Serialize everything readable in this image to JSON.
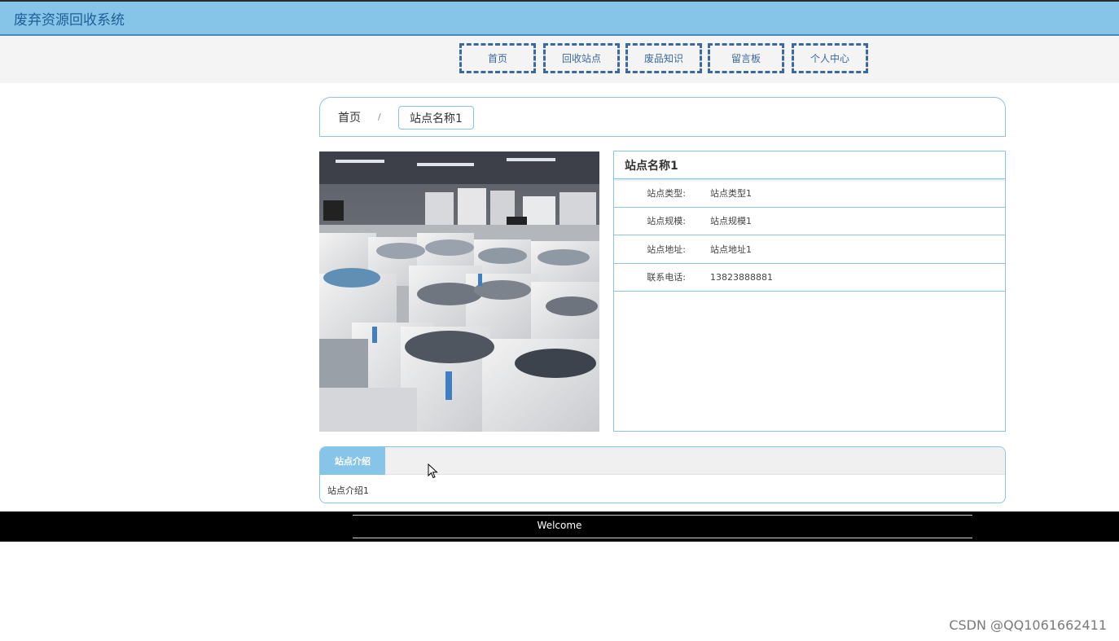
{
  "header": {
    "site_title": "废弃资源回收系统"
  },
  "nav": {
    "items": [
      {
        "label": "首页"
      },
      {
        "label": "回收站点"
      },
      {
        "label": "废品知识"
      },
      {
        "label": "留言板"
      },
      {
        "label": "个人中心"
      }
    ]
  },
  "breadcrumb": {
    "home": "首页",
    "separator": "/",
    "current": "站点名称1"
  },
  "detail": {
    "title": "站点名称1",
    "fields": [
      {
        "label": "站点类型:",
        "value": "站点类型1"
      },
      {
        "label": "站点规模:",
        "value": "站点规模1"
      },
      {
        "label": "站点地址:",
        "value": "站点地址1"
      },
      {
        "label": "联系电话:",
        "value": "13823888881"
      }
    ]
  },
  "intro": {
    "tab_label": "站点介绍",
    "content": "站点介绍1"
  },
  "footer": {
    "text": "Welcome"
  },
  "watermark": "CSDN @QQ1061662411",
  "colors": {
    "accent": "#86c4e8",
    "nav_border": "#3a68a0",
    "panel_border": "#8cc4e6"
  }
}
